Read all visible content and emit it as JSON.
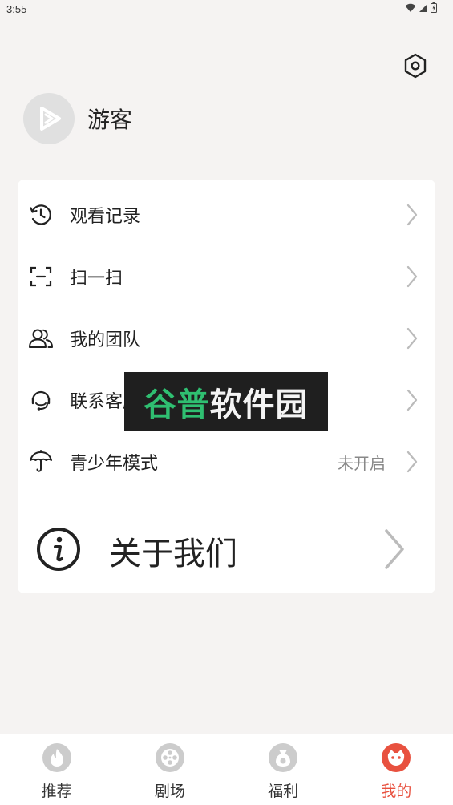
{
  "status_bar": {
    "time": "3:55"
  },
  "profile": {
    "username": "游客"
  },
  "menu": {
    "items": [
      {
        "label": "观看记录",
        "value": ""
      },
      {
        "label": "扫一扫",
        "value": ""
      },
      {
        "label": "我的团队",
        "value": ""
      },
      {
        "label": "联系客服",
        "value": ""
      },
      {
        "label": "青少年模式",
        "value": "未开启"
      }
    ],
    "about_label": "关于我们"
  },
  "watermark": {
    "text_a": "谷普",
    "text_b": "软件园"
  },
  "tabbar": {
    "tabs": [
      {
        "label": "推荐",
        "icon": "flame-icon"
      },
      {
        "label": "剧场",
        "icon": "film-reel-icon"
      },
      {
        "label": "福利",
        "icon": "money-bag-icon"
      },
      {
        "label": "我的",
        "icon": "profile-face-icon"
      }
    ],
    "active_index": 3,
    "active_color": "#e8513f",
    "inactive_color": "#cccccc"
  }
}
